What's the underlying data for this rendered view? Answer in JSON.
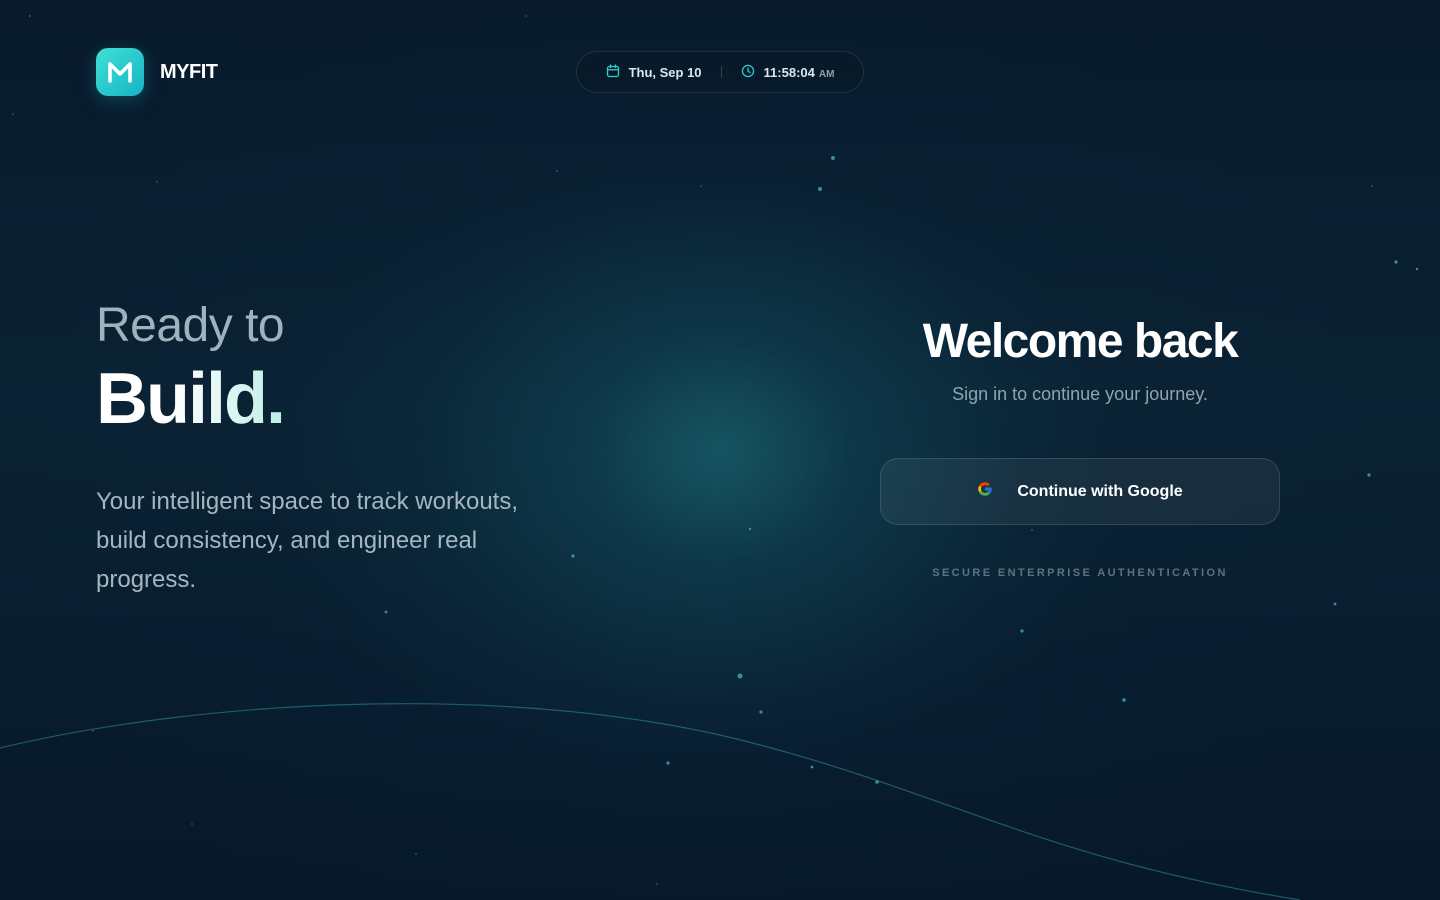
{
  "brand": {
    "name": "MYFIT",
    "logo_letter": "M",
    "accent": "#2ccfd0"
  },
  "header": {
    "date": "Thu, Sep 10",
    "time": "11:58:04",
    "ampm": "AM",
    "date_icon": "calendar-icon",
    "time_icon": "clock-icon"
  },
  "hero": {
    "line1": "Ready to",
    "line2": "Build.",
    "description": "Your intelligent space to track workouts, build consistency, and engineer real progress."
  },
  "auth": {
    "title": "Welcome back",
    "subtitle": "Sign in to continue your journey.",
    "google_button_label": "Continue with Google",
    "google_icon": "google-icon",
    "secure_note": "SECURE ENTERPRISE AUTHENTICATION"
  },
  "colors": {
    "background": "#07172a",
    "teal_accent": "#2ccfd0",
    "muted_text": "#a6b6c0"
  }
}
